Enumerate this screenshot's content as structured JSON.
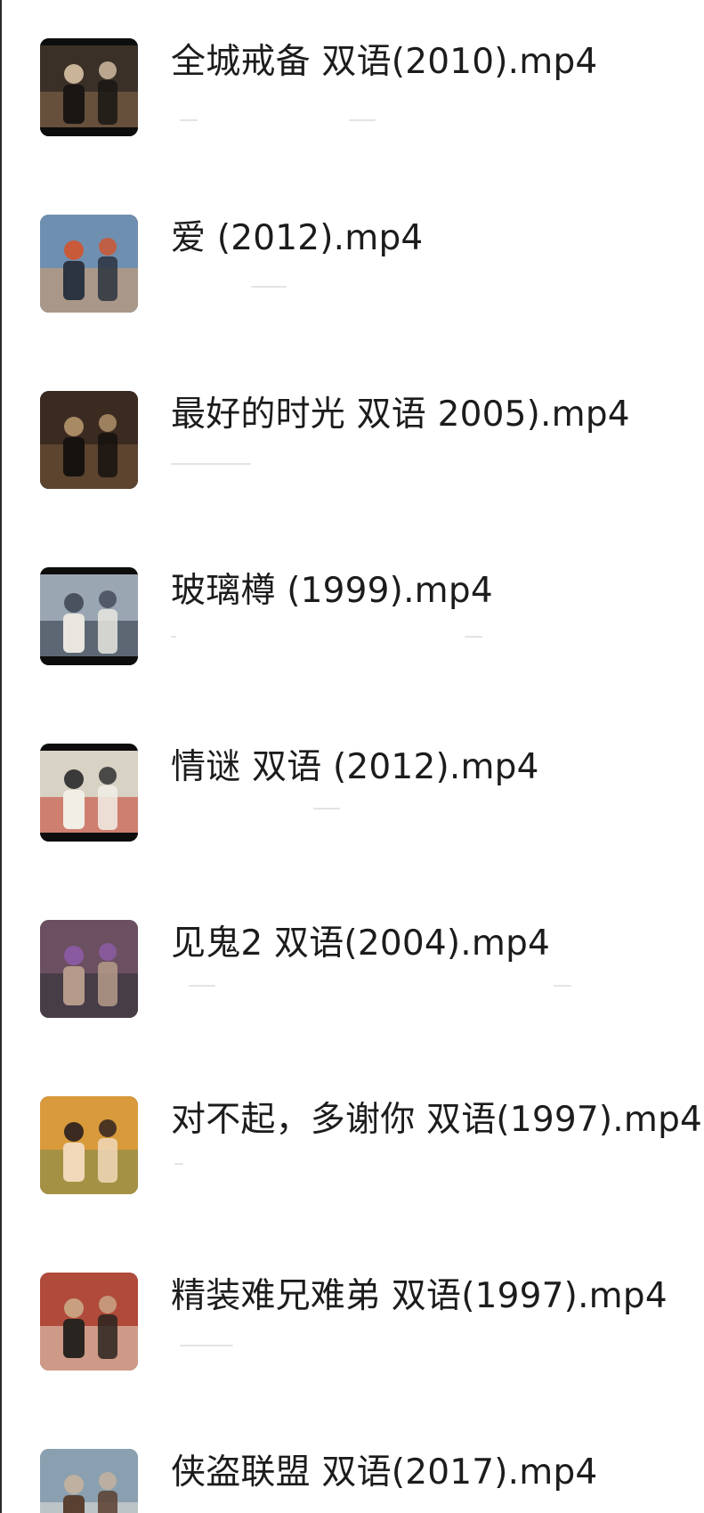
{
  "files": [
    {
      "name": "全城戒备 双语(2010).mp4",
      "thumbnail_icon": "video-thumbnail",
      "thumb_palette": [
        "#3a3027",
        "#8a6b4f",
        "#1a1614",
        "#c9b49a"
      ]
    },
    {
      "name": "爱 (2012).mp4",
      "thumbnail_icon": "video-thumbnail",
      "thumb_palette": [
        "#6f8fb0",
        "#d9a06a",
        "#2b3440",
        "#c85a3a"
      ]
    },
    {
      "name": "最好的时光 双语 2005).mp4",
      "thumbnail_icon": "video-thumbnail",
      "thumb_palette": [
        "#3b2a20",
        "#7a5a3c",
        "#15120f",
        "#a88a64"
      ]
    },
    {
      "name": "玻璃樽 (1999).mp4",
      "thumbnail_icon": "video-thumbnail",
      "thumb_palette": [
        "#9aa7b3",
        "#2c3340",
        "#e8e6df",
        "#4a5260"
      ]
    },
    {
      "name": "情谜 双语 (2012).mp4",
      "thumbnail_icon": "video-thumbnail",
      "thumb_palette": [
        "#d7d2c4",
        "#c83a2c",
        "#f1eee6",
        "#3a3a3a"
      ]
    },
    {
      "name": "见鬼2 双语(2004).mp4",
      "thumbnail_icon": "video-thumbnail",
      "thumb_palette": [
        "#6a5060",
        "#2a2d33",
        "#b59a8a",
        "#8a5aa0"
      ]
    },
    {
      "name": "对不起，多谢你 双语(1997).mp4",
      "thumbnail_icon": "video-thumbnail",
      "thumb_palette": [
        "#d99a3c",
        "#7a8a4a",
        "#f0d8b8",
        "#3a2a20"
      ]
    },
    {
      "name": "精装难兄难弟 双语(1997).mp4",
      "thumbnail_icon": "video-thumbnail",
      "thumb_palette": [
        "#b04a3a",
        "#e8dcc8",
        "#2a2420",
        "#c8a080"
      ]
    },
    {
      "name": "侠盗联盟 双语(2017).mp4",
      "thumbnail_icon": "video-thumbnail",
      "thumb_palette": [
        "#8aa0b0",
        "#e8e2d8",
        "#5a4030",
        "#c0b0a0"
      ]
    }
  ]
}
